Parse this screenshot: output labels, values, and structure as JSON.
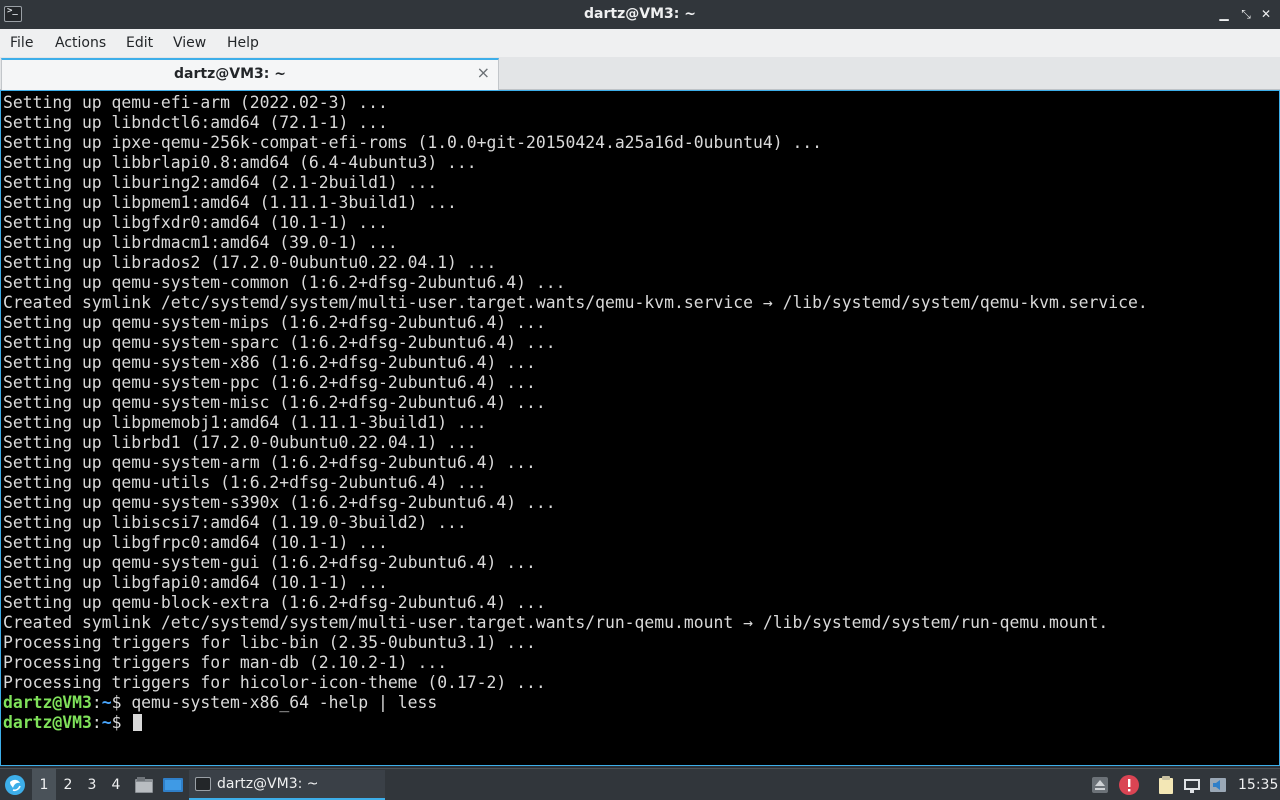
{
  "window": {
    "title": "dartz@VM3: ~",
    "controls": [
      "minimize-icon",
      "restore-icon",
      "close-icon"
    ]
  },
  "menu": [
    "File",
    "Actions",
    "Edit",
    "View",
    "Help"
  ],
  "tab": {
    "label": "dartz@VM3: ~",
    "close": "×"
  },
  "terminal": {
    "lines": [
      "Setting up qemu-efi-arm (2022.02-3) ...",
      "Setting up libndctl6:amd64 (72.1-1) ...",
      "Setting up ipxe-qemu-256k-compat-efi-roms (1.0.0+git-20150424.a25a16d-0ubuntu4) ...",
      "Setting up libbrlapi0.8:amd64 (6.4-4ubuntu3) ...",
      "Setting up liburing2:amd64 (2.1-2build1) ...",
      "Setting up libpmem1:amd64 (1.11.1-3build1) ...",
      "Setting up libgfxdr0:amd64 (10.1-1) ...",
      "Setting up librdmacm1:amd64 (39.0-1) ...",
      "Setting up librados2 (17.2.0-0ubuntu0.22.04.1) ...",
      "Setting up qemu-system-common (1:6.2+dfsg-2ubuntu6.4) ...",
      "Created symlink /etc/systemd/system/multi-user.target.wants/qemu-kvm.service → /lib/systemd/system/qemu-kvm.service.",
      "Setting up qemu-system-mips (1:6.2+dfsg-2ubuntu6.4) ...",
      "Setting up qemu-system-sparc (1:6.2+dfsg-2ubuntu6.4) ...",
      "Setting up qemu-system-x86 (1:6.2+dfsg-2ubuntu6.4) ...",
      "Setting up qemu-system-ppc (1:6.2+dfsg-2ubuntu6.4) ...",
      "Setting up qemu-system-misc (1:6.2+dfsg-2ubuntu6.4) ...",
      "Setting up libpmemobj1:amd64 (1.11.1-3build1) ...",
      "Setting up librbd1 (17.2.0-0ubuntu0.22.04.1) ...",
      "Setting up qemu-system-arm (1:6.2+dfsg-2ubuntu6.4) ...",
      "Setting up qemu-utils (1:6.2+dfsg-2ubuntu6.4) ...",
      "Setting up qemu-system-s390x (1:6.2+dfsg-2ubuntu6.4) ...",
      "Setting up libiscsi7:amd64 (1.19.0-3build2) ...",
      "Setting up libgfrpc0:amd64 (10.1-1) ...",
      "Setting up qemu-system-gui (1:6.2+dfsg-2ubuntu6.4) ...",
      "Setting up libgfapi0:amd64 (10.1-1) ...",
      "Setting up qemu-block-extra (1:6.2+dfsg-2ubuntu6.4) ...",
      "Created symlink /etc/systemd/system/multi-user.target.wants/run-qemu.mount → /lib/systemd/system/run-qemu.mount.",
      "Processing triggers for libc-bin (2.35-0ubuntu3.1) ...",
      "Processing triggers for man-db (2.10.2-1) ...",
      "Processing triggers for hicolor-icon-theme (0.17-2) ..."
    ],
    "prompt_user": "dartz@VM3",
    "prompt_sep": ":",
    "prompt_path": "~",
    "prompt_symbol": "$ ",
    "command_1": "qemu-system-x86_64 -help | less",
    "command_2": ""
  },
  "taskbar": {
    "workspaces": [
      "1",
      "2",
      "3",
      "4"
    ],
    "active_workspace": "1",
    "task_label": "dartz@VM3: ~",
    "clock": "15:35"
  },
  "colors": {
    "accent": "#3daee9",
    "prompt_user": "#7fe25a",
    "prompt_path": "#4aa8ff",
    "terminal_bg": "#000000",
    "alert": "#da4453"
  }
}
